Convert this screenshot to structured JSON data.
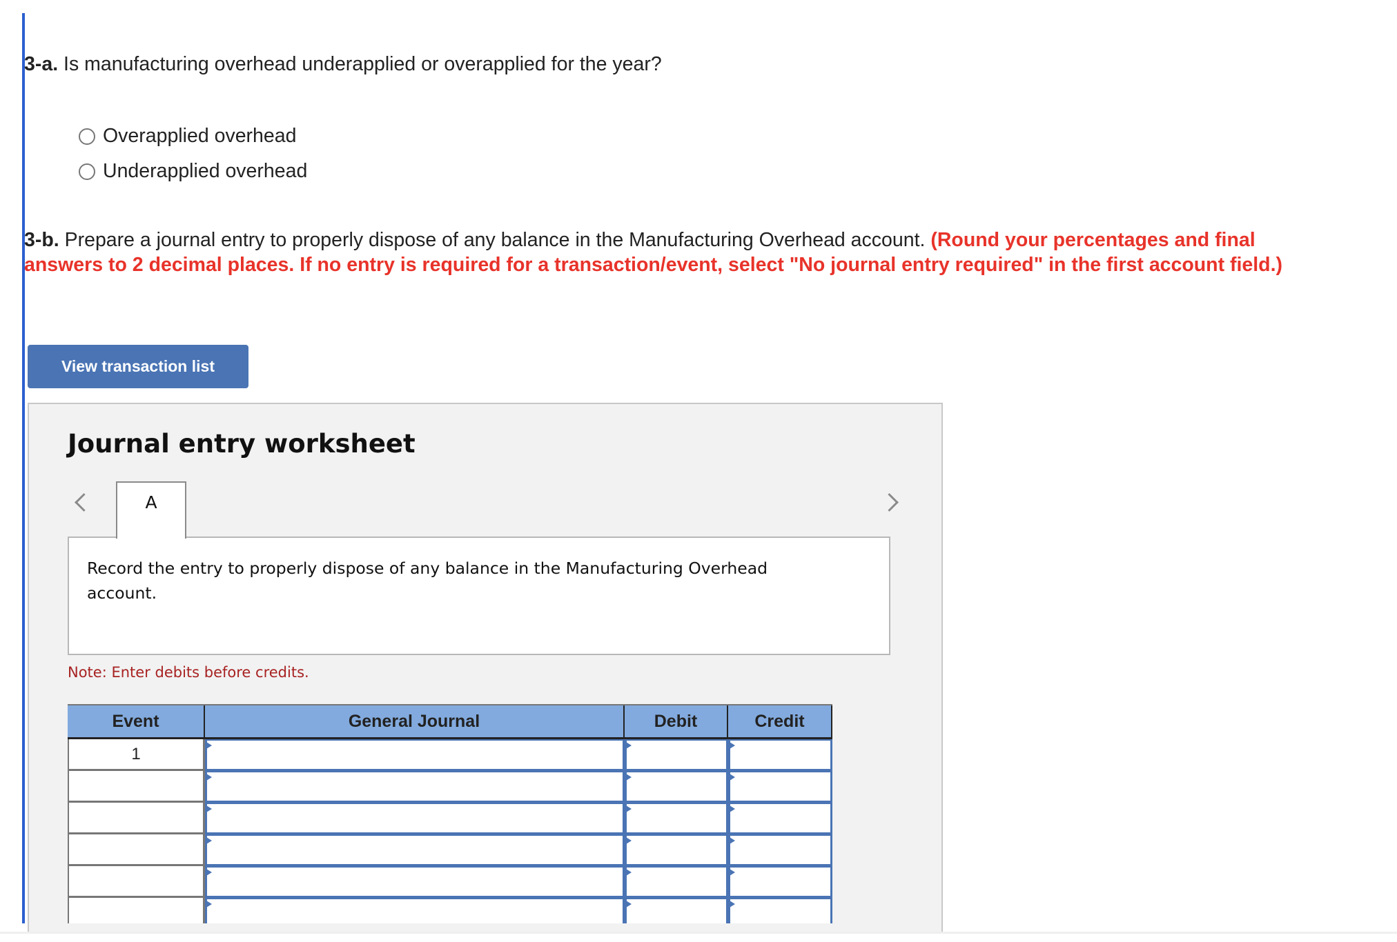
{
  "question_3a": {
    "label": "3-a.",
    "text": " Is manufacturing overhead underapplied or overapplied for the year?",
    "options": [
      {
        "label": "Overapplied overhead",
        "selected": false
      },
      {
        "label": "Underapplied overhead",
        "selected": false
      }
    ]
  },
  "question_3b": {
    "label": "3-b.",
    "text": " Prepare a journal entry to properly dispose of any balance in the Manufacturing Overhead account. ",
    "instruction": "(Round your percentages and final answers to 2 decimal places. If no entry is required for a transaction/event, select \"No journal entry required\" in the first account field.)"
  },
  "view_transaction_button": "View transaction list",
  "worksheet": {
    "title": "Journal entry worksheet",
    "tabs": [
      {
        "label": "A",
        "active": true
      }
    ],
    "description": "Record the entry to properly dispose of any balance in the Manufacturing Overhead account.",
    "note": "Note: Enter debits before credits.",
    "table": {
      "headers": [
        "Event",
        "General Journal",
        "Debit",
        "Credit"
      ],
      "rows": [
        {
          "event": "1",
          "account": "",
          "debit": "",
          "credit": ""
        },
        {
          "event": "",
          "account": "",
          "debit": "",
          "credit": ""
        },
        {
          "event": "",
          "account": "",
          "debit": "",
          "credit": ""
        },
        {
          "event": "",
          "account": "",
          "debit": "",
          "credit": ""
        },
        {
          "event": "",
          "account": "",
          "debit": "",
          "credit": ""
        },
        {
          "event": "",
          "account": "",
          "debit": "",
          "credit": ""
        }
      ]
    }
  },
  "colors": {
    "accent_blue": "#4a74b4",
    "instruction_red": "#e8332a",
    "note_red": "#a82222",
    "table_header": "#82aade"
  }
}
